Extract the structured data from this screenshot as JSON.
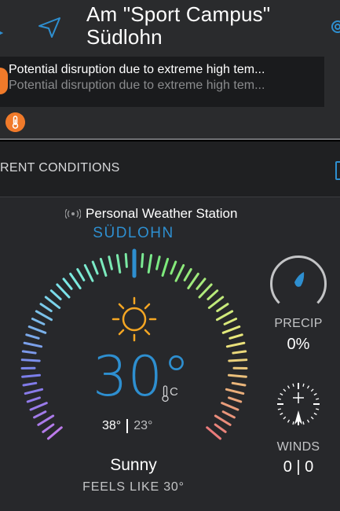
{
  "header": {
    "location_name": "Am \"Sport Campus\" Südlohn",
    "alert_line_1": "Potential disruption due to extreme high tem...",
    "alert_line_2": "Potential disruption due to extreme high tem..."
  },
  "section": {
    "title": "RENT CONDITIONS"
  },
  "conditions": {
    "source": "Personal Weather Station",
    "city": "SÜDLOHN",
    "temperature": "30°",
    "unit": "C",
    "high": "38°",
    "low": "23°",
    "condition": "Sunny",
    "feels_like": "FEELS LIKE 30°",
    "precip_label": "PRECIP",
    "precip_value": "0%",
    "winds_label": "WINDS",
    "winds_value": "0 | 0"
  },
  "colors": {
    "accent": "#2e8fd0",
    "alert": "#f07a2a",
    "sun": "#f5a623"
  }
}
